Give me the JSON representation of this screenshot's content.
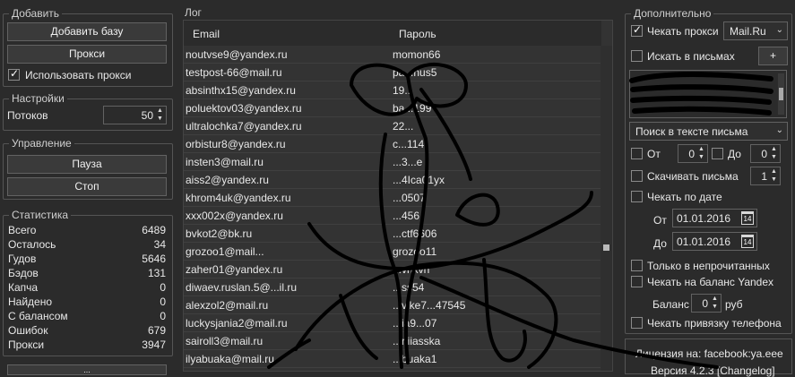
{
  "add": {
    "title": "Добавить",
    "add_base_label": "Добавить базу",
    "proxy_label": "Прокси",
    "use_proxy_label": "Использовать прокси",
    "use_proxy_checked": true
  },
  "settings": {
    "title": "Настройки",
    "threads_label": "Потоков",
    "threads_value": "50"
  },
  "control": {
    "title": "Управление",
    "pause_label": "Пауза",
    "stop_label": "Стоп"
  },
  "stats": {
    "title": "Статистика",
    "rows": [
      {
        "label": "Всего",
        "value": "6489"
      },
      {
        "label": "Осталось",
        "value": "34"
      },
      {
        "label": "Гудов",
        "value": "5646"
      },
      {
        "label": "Бэдов",
        "value": "131"
      },
      {
        "label": "Капча",
        "value": "0"
      },
      {
        "label": "Найдено",
        "value": "0"
      },
      {
        "label": "С балансом",
        "value": "0"
      },
      {
        "label": "Ошибок",
        "value": "679"
      },
      {
        "label": "Прокси",
        "value": "3947"
      }
    ]
  },
  "log": {
    "title": "Лог",
    "col_email": "Email",
    "col_password": "Пароль",
    "rows": [
      {
        "email": "noutvse9@yandex.ru",
        "password": "momon66"
      },
      {
        "email": "testpost-66@mail.ru",
        "password": "pa...nus5"
      },
      {
        "email": "absinthx15@yandex.ru",
        "password": "19..."
      },
      {
        "email": "poluektov03@yandex.ru",
        "password": "ba...199"
      },
      {
        "email": "ultralochka7@yandex.ru",
        "password": "22..."
      },
      {
        "email": "orbistur8@yandex.ru",
        "password": "c...114"
      },
      {
        "email": "insten3@mail.ru",
        "password": "...3...e"
      },
      {
        "email": "aiss2@yandex.ru",
        "password": "...4Ica01yx"
      },
      {
        "email": "khrom4uk@yandex.ru",
        "password": "...0507"
      },
      {
        "email": "xxx002x@yandex.ru",
        "password": "...456"
      },
      {
        "email": "bvkot2@bk.ru",
        "password": "...ctf6606"
      },
      {
        "email": "grozoo1@mail...",
        "password": "grozoo11"
      },
      {
        "email": "zaher01@yandex.ru",
        "password": "...vnxvn"
      },
      {
        "email": "diwaev.ruslan.5@...il.ru",
        "password": "...ss54"
      },
      {
        "email": "alexzol2@mail.ru",
        "password": "...vike7...47545"
      },
      {
        "email": "luckysjania2@mail.ru",
        "password": "...ia9...07"
      },
      {
        "email": "sairoll3@mail.ru",
        "password": "...niiasska"
      },
      {
        "email": "ilyabuaka@mail.ru",
        "password": "...buaka1"
      }
    ]
  },
  "extra": {
    "title": "Дополнительно",
    "check_proxy_label": "Чекать прокси",
    "check_proxy_checked": true,
    "provider_value": "Mail.Ru",
    "search_mails_label": "Искать в письмах",
    "search_mails_checked": false,
    "add_plus_label": "+",
    "search_mode_value": "Поиск в тексте письма",
    "from_label": "От",
    "from_value": "0",
    "to_label": "До",
    "to_value": "0",
    "download_label": "Скачивать письма",
    "download_value": "1",
    "check_by_date_label": "Чекать по дате",
    "date_from_label": "От",
    "date_from_value": "01.01.2016",
    "date_to_label": "До",
    "date_to_value": "01.01.2016",
    "calendar_icon_text": "14",
    "unread_only_label": "Только в непрочитанных",
    "check_balance_label": "Чекать на баланс Yandex",
    "balance_from_label": "Баланс от",
    "balance_value": "0",
    "balance_unit": "руб",
    "check_phone_label": "Чекать привязку телефона"
  },
  "license": {
    "line1": "Лицензия на: facebook:ya.eee",
    "line2": "Версия 4.2.3 [Changelog]"
  },
  "bottom_button_label": "..."
}
